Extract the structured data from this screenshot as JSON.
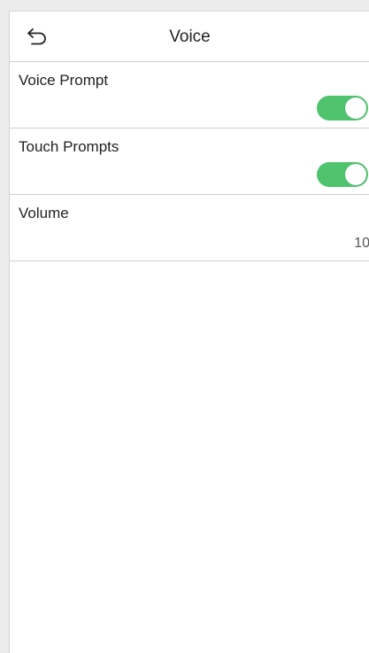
{
  "header": {
    "title": "Voice",
    "back_icon": "back-arrow-icon"
  },
  "settings": {
    "voice_prompt": {
      "label": "Voice Prompt",
      "enabled": true
    },
    "touch_prompts": {
      "label": "Touch Prompts",
      "enabled": true
    },
    "volume": {
      "label": "Volume",
      "value": "10"
    }
  },
  "colors": {
    "toggle_on": "#4fc36e",
    "divider": "#cfcfcf",
    "background": "#ffffff"
  }
}
